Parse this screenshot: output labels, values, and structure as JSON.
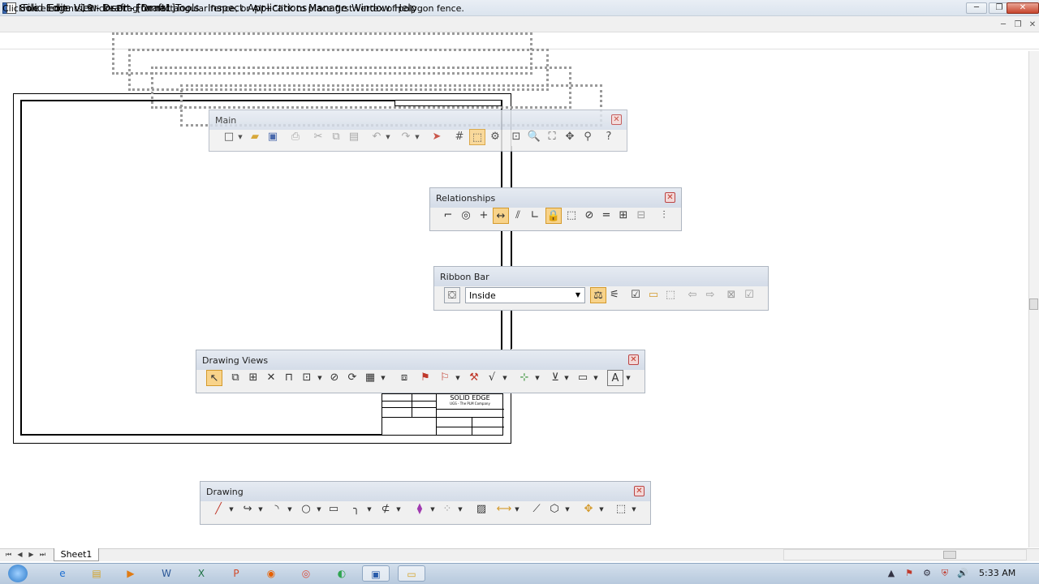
{
  "window": {
    "title": "Solid Edge V19 - Draft - [Draft1]",
    "minimize": "─",
    "maximize": "❐",
    "close": "✕"
  },
  "menu": [
    "File",
    "Edit",
    "View",
    "Insert",
    "Format",
    "Tools",
    "Inspect",
    "Applications",
    "Manage",
    "Window",
    "Help"
  ],
  "mdi_controls": {
    "minimize": "─",
    "restore": "❐",
    "close": "✕"
  },
  "prompt": "Click on elements, Click+Drag for rectangular fence, or Alt+Click to place first vertex of polygon fence.",
  "sheet": {
    "title_block_company": "SOLID EDGE",
    "title_block_sub": "UGS - The PLM Company"
  },
  "toolbars": {
    "main": {
      "title": "Main",
      "close": "✕",
      "tools": [
        "new-icon",
        "open-icon",
        "save-icon",
        "print-icon",
        "cut-icon",
        "copy-icon",
        "paste-icon",
        "undo-icon",
        "redo-icon",
        "select-icon",
        "grid-icon",
        "ribbon-icon",
        "properties-icon",
        "zoom-area-icon",
        "zoom-icon",
        "fit-icon",
        "pan-icon",
        "help-icon"
      ]
    },
    "relationships": {
      "title": "Relationships",
      "close": "✕"
    },
    "ribbon_bar": {
      "title": "Ribbon Bar",
      "close": "",
      "combo_value": "Inside"
    },
    "drawing_views": {
      "title": "Drawing Views",
      "close": "✕"
    },
    "drawing": {
      "title": "Drawing",
      "close": "✕"
    }
  },
  "sheet_tabs": {
    "active": "Sheet1"
  },
  "taskbar": {
    "apps": [
      "ie-icon",
      "explorer-icon",
      "media-player-icon",
      "word-icon",
      "excel-icon",
      "powerpoint-icon",
      "firefox-icon",
      "chrome-icon",
      "camtasia-icon",
      "solid-edge-icon",
      "folder-icon"
    ],
    "clock": "5:33 AM"
  },
  "colors": {
    "active_tool": "#f8d38a",
    "toolbar_bg": "#f0f0f0",
    "title_gradient": "#dbe4ee",
    "taskbar": "#b7c9dd"
  }
}
